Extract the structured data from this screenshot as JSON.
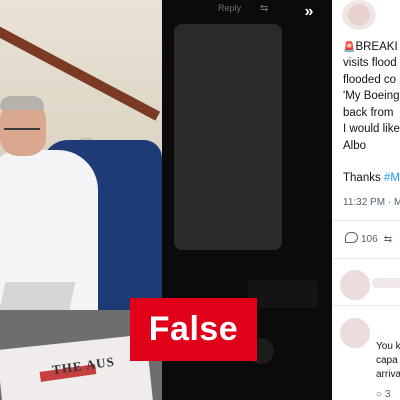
{
  "media_viewer": {
    "photo": {
      "newspaper_headline": "THE AUS"
    },
    "top_bar": {
      "reply_label": "Reply",
      "repost_icon": "repost-icon",
      "expand_icon": "double-chevron-right-icon"
    }
  },
  "fact_check": {
    "verdict": "False",
    "color": "#e0001a"
  },
  "tweet": {
    "lines": [
      "BREAKI",
      "visits flood",
      "flooded co",
      "'My Boeing",
      "back from",
      "I would like",
      "Albo"
    ],
    "thanks_prefix": "Thanks ",
    "hashtag": "#M",
    "timestamp": "11:32 PM · M",
    "reply_count": "106",
    "hashtag_color": "#1d9bf0"
  },
  "replies": [
    {
      "text_lines": [
        "You k",
        "capa",
        "arriva"
      ],
      "stat": "3"
    }
  ]
}
